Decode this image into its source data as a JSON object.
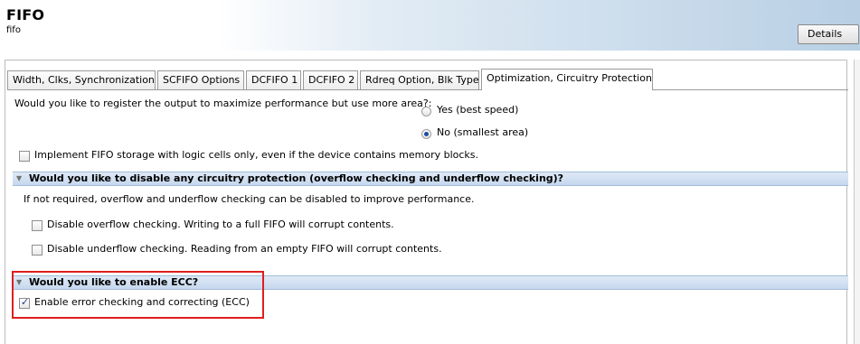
{
  "header": {
    "title": "FIFO",
    "subtitle": "fifo",
    "details_label": "Details"
  },
  "tabs": [
    "Width, Clks, Synchronization",
    "SCFIFO Options",
    "DCFIFO 1",
    "DCFIFO 2",
    "Rdreq Option, Blk Type",
    "Optimization, Circuitry Protection"
  ],
  "active_tab": "Optimization, Circuitry Protection",
  "register_output": {
    "question": "Would you like to register the output to maximize performance but use more area?:",
    "options": [
      "Yes (best speed)",
      "No (smallest area)"
    ],
    "selected": "No (smallest area)"
  },
  "logic_cells": {
    "label": "Implement FIFO storage with logic cells only, even if the device contains memory blocks.",
    "checked": false
  },
  "protection": {
    "title": "Would you like to disable any circuitry protection (overflow checking and underflow checking)?",
    "description": "If not required, overflow and underflow checking can be disabled to improve performance.",
    "overflow": {
      "label": "Disable overflow checking. Writing to a full FIFO will corrupt contents.",
      "checked": false
    },
    "underflow": {
      "label": "Disable underflow checking. Reading from an empty FIFO will corrupt contents.",
      "checked": false
    }
  },
  "ecc": {
    "title": "Would you like to enable ECC?",
    "label": "Enable error checking and correcting (ECC)",
    "checked": true
  },
  "colors": {
    "highlight": "#e01e1e",
    "section_bg": "#c6d8ee",
    "radio_dot": "#1f4ca0"
  }
}
